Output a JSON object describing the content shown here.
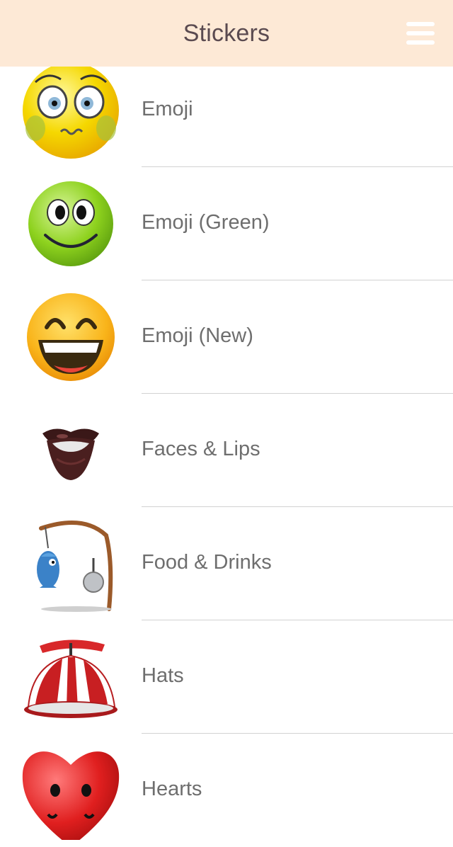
{
  "navbar": {
    "title": "Stickers",
    "menu_icon": "hamburger-menu-icon"
  },
  "categories": [
    {
      "label": "Emoji",
      "icon": "nervous-smiley-icon"
    },
    {
      "label": "Emoji (Green)",
      "icon": "green-smiley-icon"
    },
    {
      "label": "Emoji (New)",
      "icon": "grinning-smiley-icon"
    },
    {
      "label": "Faces & Lips",
      "icon": "lips-icon"
    },
    {
      "label": "Food & Drinks",
      "icon": "fishing-rod-icon"
    },
    {
      "label": "Hats",
      "icon": "propeller-hat-icon"
    },
    {
      "label": "Hearts",
      "icon": "heart-face-icon"
    }
  ]
}
